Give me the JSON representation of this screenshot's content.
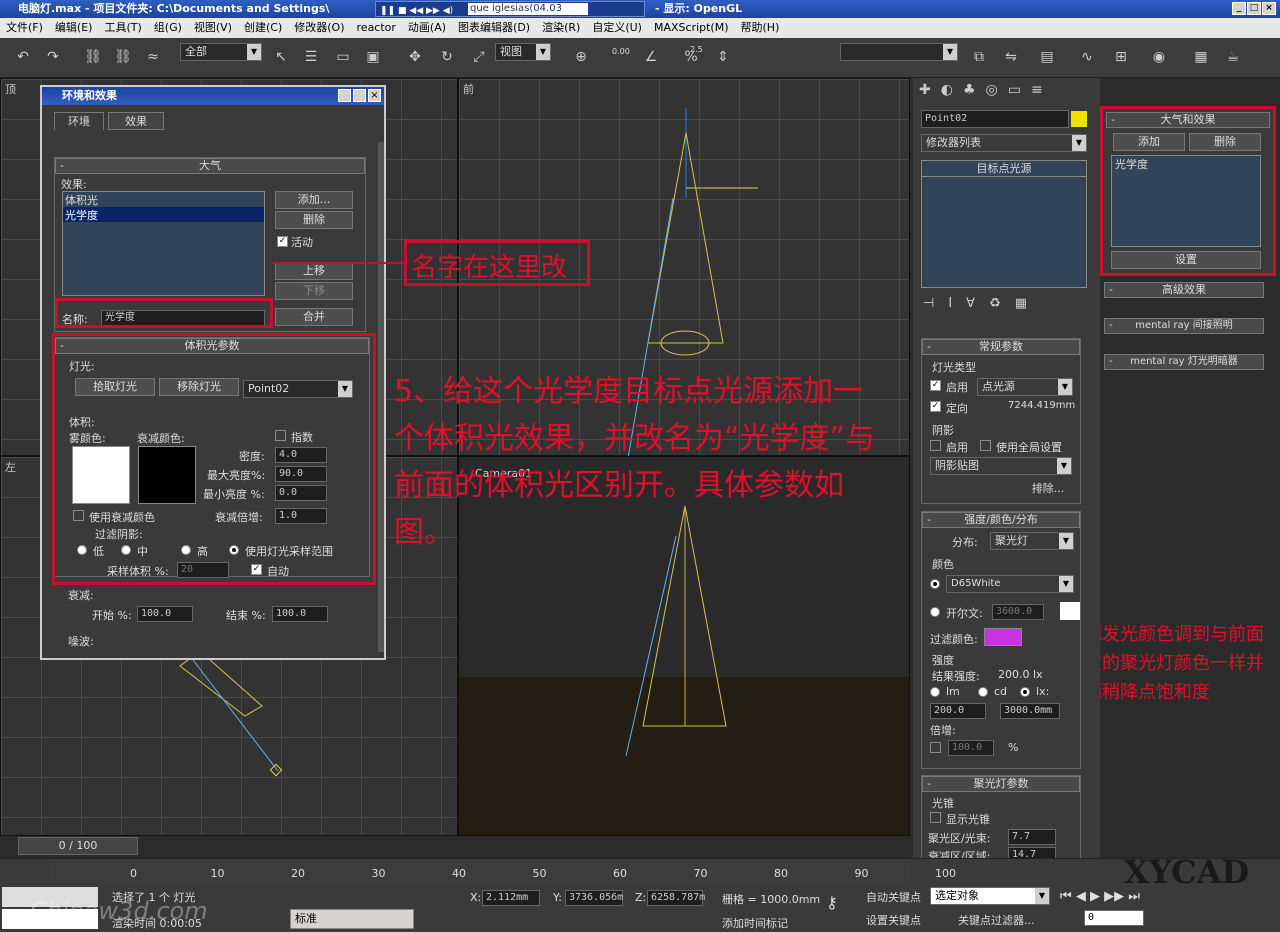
{
  "window": {
    "title": "电脑灯.max - 项目文件夹: C:\\Documents and Settings\\",
    "display": "- 显示: OpenGL",
    "media_text": "que iglesias(04.03"
  },
  "menu": [
    "文件(F)",
    "编辑(E)",
    "工具(T)",
    "组(G)",
    "视图(V)",
    "创建(C)",
    "修改器(O)",
    "reactor",
    "动画(A)",
    "图表编辑器(D)",
    "渲染(R)",
    "自定义(U)",
    "MAXScript(M)",
    "帮助(H)"
  ],
  "toolbar": {
    "selection_filter": "全部",
    "ref_coord": "视图",
    "angle_snap": "0.00",
    "spinner_snap": "2.5",
    "named_sel": "",
    "icon_names": [
      "undo-icon",
      "redo-icon",
      "link-icon",
      "unlink-icon",
      "bind-space-warp-icon",
      "select-icon",
      "select-by-name-icon",
      "rect-select-icon",
      "window-crossing-icon",
      "move-icon",
      "rotate-icon",
      "scale-icon",
      "snap-icon",
      "angle-snap-icon",
      "percent-snap-icon",
      "spinner-snap-icon",
      "mirror-icon",
      "align-icon",
      "layers-icon",
      "curve-editor-icon",
      "schematic-icon",
      "material-editor-icon",
      "render-setup-icon",
      "render-icon"
    ]
  },
  "viewports": {
    "top": "顶",
    "front": "前",
    "left": "左",
    "camera": "Camera01"
  },
  "env": {
    "title": "环境和效果",
    "tabs": [
      "环境",
      "效果"
    ],
    "atmos": {
      "header": "大气",
      "effects_label": "效果:",
      "effects": [
        "体积光",
        "光学度"
      ],
      "selected": 1,
      "add": "添加...",
      "delete": "删除",
      "active": "活动",
      "move_up": "上移",
      "move_down": "下移",
      "name_label": "名称:",
      "name_value": "光学度",
      "merge": "合并"
    },
    "vol": {
      "header": "体积光参数",
      "lights_label": "灯光:",
      "pick": "拾取灯光",
      "remove": "移除灯光",
      "light": "Point02",
      "volume_label": "体积:",
      "fog_color": "雾颜色:",
      "atten_color": "衰减颜色:",
      "exponential": "指数",
      "density_label": "密度:",
      "density": "4.0",
      "max_label": "最大亮度%:",
      "max": "90.0",
      "min_label": "最小亮度 %:",
      "min": "0.0",
      "atten_mult_label": "衰减倍增:",
      "atten_mult": "1.0",
      "use_atten": "使用衰减颜色",
      "filter_shadows": "过滤阴影:",
      "low": "低",
      "mid": "中",
      "high": "高",
      "use_sample": "使用灯光采样范围",
      "sample_label": "采样体积 %:",
      "sample": "20",
      "auto": "自动"
    },
    "atten": {
      "header": "衰减:",
      "start_label": "开始 %:",
      "start": "100.0",
      "end_label": "结束 %:",
      "end": "100.0"
    },
    "noise": "噪波:"
  },
  "annotations": {
    "name": "名字在这里改",
    "step": "5、给这个光学度目标点光源添加一个体积光效果，并改名为“光学度”与前面的体积光区别开。具体参数如图。",
    "color": "把发光颜色调到与前面做的聚光灯颜色一样并稍稍降点饱和度"
  },
  "cmd": {
    "tab_icons": [
      "create-icon",
      "modify-icon",
      "hierarchy-icon",
      "motion-icon",
      "display-icon",
      "utilities-icon"
    ],
    "obj_name": "Point02",
    "mod_list": "修改器列表",
    "stack_item": "目标点光源",
    "general": {
      "header": "常规参数",
      "light_type": "灯光类型",
      "enable": "启用",
      "type": "点光源",
      "targeted": "定向",
      "dist": "7244.419mm",
      "shadows": "阴影",
      "shadow_enable": "启用",
      "global": "使用全局设置",
      "shadow_type": "阴影贴图",
      "exclude": "排除..."
    },
    "intensity": {
      "header": "强度/颜色/分布",
      "dist_label": "分布:",
      "dist": "聚光灯",
      "color_label": "颜色",
      "preset": "D65White",
      "kelvin_label": "开尔文:",
      "kelvin": "3600.0",
      "filter_label": "过滤颜色:",
      "filter_color": "#c832e0",
      "int_label": "强度",
      "result_label": "结果强度:",
      "result": "200.0 lx",
      "lm": "lm",
      "cd": "cd",
      "lx": "lx:",
      "val1": "200.0",
      "val2": "3000.0mm",
      "mult_label": "倍增:",
      "mult": "100.0",
      "pct": "%"
    },
    "spot": {
      "header": "聚光灯参数",
      "cone": "光锥",
      "show_cone": "显示光锥",
      "hotspot_label": "聚光区/光束:",
      "hotspot": "7.7",
      "falloff_label": "衰减区/区域:",
      "falloff": "14.7"
    }
  },
  "atmos_panel": {
    "header": "大气和效果",
    "add": "添加",
    "delete": "删除",
    "item": "光学度",
    "setup": "设置",
    "adv": "高级效果",
    "mr1": "mental ray 间接照明",
    "mr2": "mental ray 灯光明暗器"
  },
  "status": {
    "frame": "0 / 100",
    "ticks": [
      "0",
      "10",
      "20",
      "30",
      "40",
      "50",
      "60",
      "70",
      "80",
      "90",
      "100"
    ],
    "selected": "选择了 1 个 灯光",
    "render_time": "渲染时间  0:00:05",
    "x_label": "X:",
    "x": "2.112mm",
    "y_label": "Y:",
    "y": "3736.056m",
    "z_label": "Z:",
    "z": "6258.787m",
    "grid": "栅格 = 1000.0mm",
    "auto_key": "自动关键点",
    "set_key": "设置关键点",
    "sel_obj": "选定对象",
    "key_filter": "关键点过滤器...",
    "add_tag": "添加时间标记",
    "frame_field": "0",
    "ime": "标准",
    "watermark": "Chinaw3d.com",
    "logo": "XYCAD"
  }
}
